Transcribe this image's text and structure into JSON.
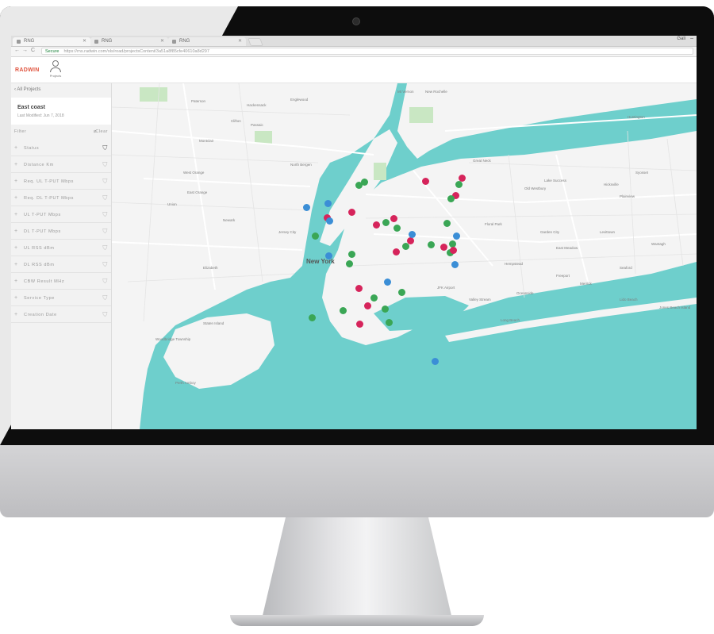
{
  "browser": {
    "tabs": [
      {
        "label": "RNG",
        "active": true
      },
      {
        "label": "RNG",
        "active": false
      },
      {
        "label": "RNG",
        "active": false
      }
    ],
    "window_user": "Gali",
    "secure_label": "Secure",
    "url": "https://rns.radwin.com/ols/road/projectsContent/3a51a8f85cfe40610a8d297"
  },
  "app": {
    "logo": "RADWIN",
    "projects_icon_label": "Projects"
  },
  "sidebar": {
    "back_label": "All Projects",
    "project_name": "East coast",
    "last_modified": "Last Modified: Jun 7, 2018",
    "filter_label": "Filter",
    "clear_label": "Clear",
    "filters": [
      {
        "label": "Status",
        "active": true
      },
      {
        "label": "Distance Km",
        "active": false
      },
      {
        "label": "Req. UL T-PUT Mbps",
        "active": false
      },
      {
        "label": "Req. DL T-PUT Mbps",
        "active": false
      },
      {
        "label": "UL T-PUT Mbps",
        "active": false
      },
      {
        "label": "DL T-PUT Mbps",
        "active": false
      },
      {
        "label": "UL RSS dBm",
        "active": false
      },
      {
        "label": "DL RSS dBm",
        "active": false
      },
      {
        "label": "CBW Result MHz",
        "active": false
      },
      {
        "label": "Service Type",
        "active": false
      },
      {
        "label": "Creation Date",
        "active": false
      }
    ]
  },
  "map": {
    "city_label": "New York",
    "labels": [
      "Mt Vernon",
      "New Rochelle",
      "Hackensack",
      "Englewood",
      "Paterson",
      "Clifton",
      "Passaic",
      "Montclair",
      "West Orange",
      "North Bergen",
      "East Orange",
      "Newark",
      "Jersey City",
      "Union",
      "Elizabeth",
      "Staten Island",
      "Woodbridge Township",
      "Perth Amboy",
      "Long Beach",
      "Freeport",
      "Hempstead",
      "Garden City",
      "Levittown",
      "Huntington",
      "Great Neck",
      "Floral Park",
      "Valley Stream",
      "Oceanside",
      "Lake Success",
      "Old Westbury",
      "Hicksville",
      "Plainview",
      "Syosset",
      "East Meadow",
      "Merrick",
      "Seaford",
      "Wantagh",
      "Lido Beach",
      "Jones Beach Island",
      "JFK Airport"
    ],
    "colors": {
      "water": "#6ecfcc",
      "land": "#f4f4f4",
      "green": "#3aa655",
      "red": "#d6245b",
      "blue": "#3b8ed6"
    }
  }
}
